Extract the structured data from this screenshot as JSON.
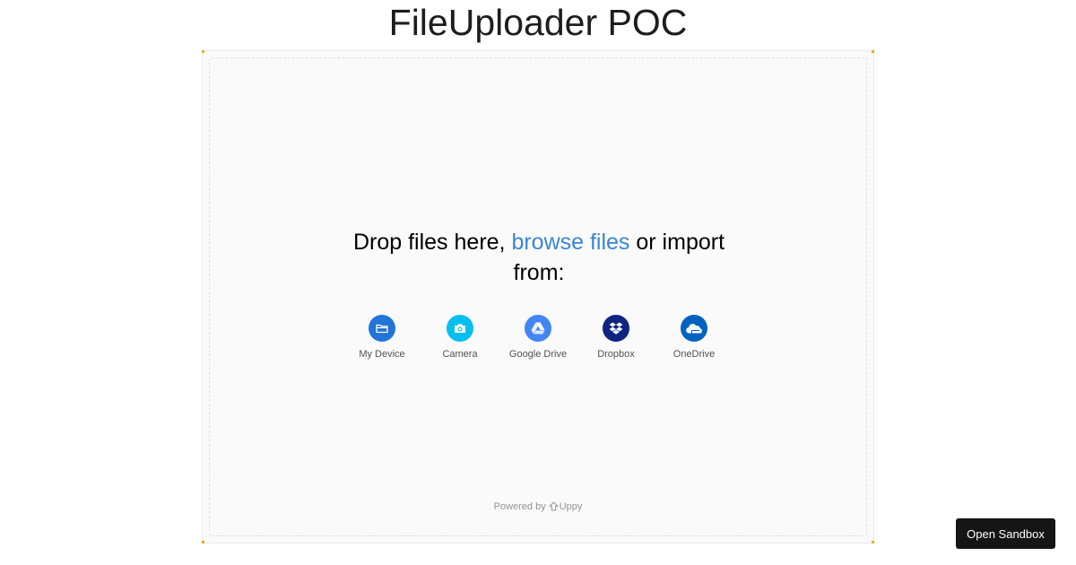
{
  "page": {
    "title": "FileUploader POC"
  },
  "dropzone": {
    "prefix": "Drop files here, ",
    "browse_link": "browse files",
    "suffix": " or import from:"
  },
  "sources": [
    {
      "label": "My Device",
      "icon": "folder-icon",
      "color": "#2275d7"
    },
    {
      "label": "Camera",
      "icon": "camera-icon",
      "color": "#03bfef"
    },
    {
      "label": "Google Drive",
      "icon": "google-drive-icon",
      "color": "#4285f4"
    },
    {
      "label": "Dropbox",
      "icon": "dropbox-icon",
      "color": "#0d2481"
    },
    {
      "label": "OneDrive",
      "icon": "onedrive-icon",
      "color": "#0262c0"
    }
  ],
  "footer": {
    "powered_by": "Powered by",
    "brand": "Uppy"
  },
  "sandbox_button": {
    "label": "Open Sandbox"
  },
  "colors": {
    "accent_link": "#3a86d6",
    "corner_accent": "#f6a623"
  }
}
